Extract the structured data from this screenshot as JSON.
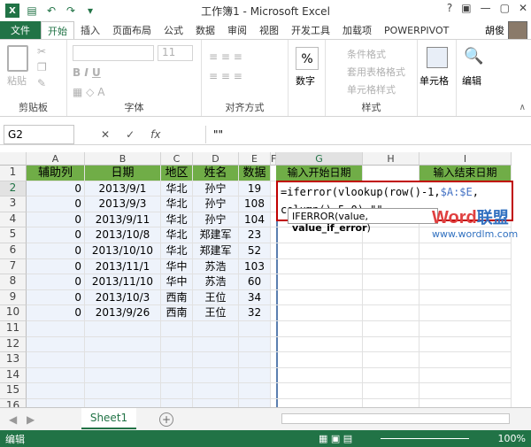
{
  "app_title": "工作簿1 - Microsoft Excel",
  "window_controls": [
    "?",
    "▣",
    "—",
    "▢",
    "✕"
  ],
  "tabs": [
    "文件",
    "开始",
    "插入",
    "页面布局",
    "公式",
    "数据",
    "审阅",
    "视图",
    "开发工具",
    "加载项",
    "POWERPIVOT"
  ],
  "user": "胡俊",
  "ribbon": {
    "paste": "粘贴",
    "clipboard": "剪贴板",
    "font_size": "11",
    "font": "字体",
    "align": "对齐方式",
    "number": "数字",
    "cond_format": "条件格式",
    "table_format": "套用表格格式",
    "cell_style": "单元格样式",
    "style": "样式",
    "cells": "单元格",
    "edit": "编辑"
  },
  "formula_bar": {
    "name_box": "G2",
    "fx": "fx",
    "content": "\"\""
  },
  "columns": [
    "A",
    "B",
    "C",
    "D",
    "E",
    "F",
    "G",
    "H",
    "I"
  ],
  "rows": [
    "1",
    "2",
    "3",
    "4",
    "5",
    "6",
    "7",
    "8",
    "9",
    "10",
    "11",
    "12",
    "13",
    "14",
    "15",
    "16"
  ],
  "headers": [
    "辅助列",
    "日期",
    "地区",
    "姓名",
    "数据"
  ],
  "data": [
    [
      "0",
      "2013/9/1",
      "华北",
      "孙宁",
      "19"
    ],
    [
      "0",
      "2013/9/3",
      "华北",
      "孙宁",
      "108"
    ],
    [
      "0",
      "2013/9/11",
      "华北",
      "孙宁",
      "104"
    ],
    [
      "0",
      "2013/10/8",
      "华北",
      "郑建军",
      "23"
    ],
    [
      "0",
      "2013/10/10",
      "华北",
      "郑建军",
      "52"
    ],
    [
      "0",
      "2013/11/1",
      "华中",
      "苏浩",
      "103"
    ],
    [
      "0",
      "2013/11/10",
      "华中",
      "苏浩",
      "60"
    ],
    [
      "0",
      "2013/10/3",
      "西南",
      "王位",
      "34"
    ],
    [
      "0",
      "2013/9/26",
      "西南",
      "王位",
      "32"
    ]
  ],
  "g1": "输入开始日期",
  "i1": "输入结束日期",
  "edit": {
    "line1a": "=iferror(vlookup(row()-1,",
    "line1b": "$A:$E",
    "line1c": ",",
    "line2": "column()-5,0),\"\""
  },
  "tooltip": {
    "a": "IFERROR(value, ",
    "b": "value_if_error",
    "c": ")"
  },
  "watermark": {
    "word": "Word",
    "cn": "联盟",
    "url": "www.wordlm.com"
  },
  "sheet": "Sheet1",
  "status_left": "编辑",
  "zoom": "100%",
  "colors": {
    "excel_green": "#217346",
    "header_green": "#70ad47",
    "selection_blue": "#eef3fb",
    "edit_border": "#c00000"
  }
}
